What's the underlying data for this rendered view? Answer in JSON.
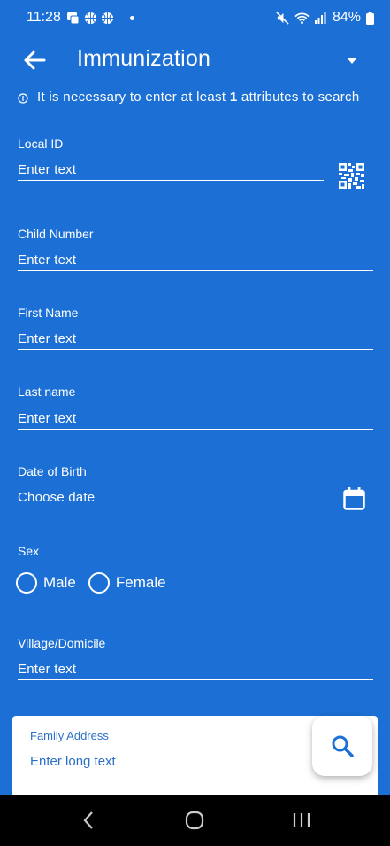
{
  "status_bar": {
    "time": "11:28",
    "battery": "84%",
    "icons": [
      "notification-icon",
      "basketball-icon",
      "basketball-icon",
      "mute-icon",
      "wifi-icon",
      "signal-icon",
      "battery-icon"
    ]
  },
  "toolbar": {
    "title": "Immunization",
    "back_icon": "arrow-back-icon",
    "menu_icon": "dropdown-arrow-icon"
  },
  "info": {
    "text_before": "It is necessary to enter at least ",
    "count": "1",
    "text_after": " attributes to search"
  },
  "fields": {
    "local_id": {
      "label": "Local ID",
      "placeholder": "Enter text"
    },
    "child_number": {
      "label": "Child Number",
      "placeholder": "Enter text"
    },
    "first_name": {
      "label": "First Name",
      "placeholder": "Enter text"
    },
    "last_name": {
      "label": "Last name",
      "placeholder": "Enter text"
    },
    "date_of_birth": {
      "label": "Date of Birth",
      "placeholder": "Choose date"
    },
    "sex": {
      "label": "Sex",
      "options": [
        "Male",
        "Female"
      ]
    },
    "village": {
      "label": "Village/Domicile",
      "placeholder": "Enter text"
    },
    "family_address": {
      "label": "Family Address",
      "placeholder": "Enter long text"
    }
  },
  "colors": {
    "background": "#1c6fd5",
    "card": "#ffffff",
    "accent_text": "#2a70c8",
    "nav_bar": "#000000"
  }
}
